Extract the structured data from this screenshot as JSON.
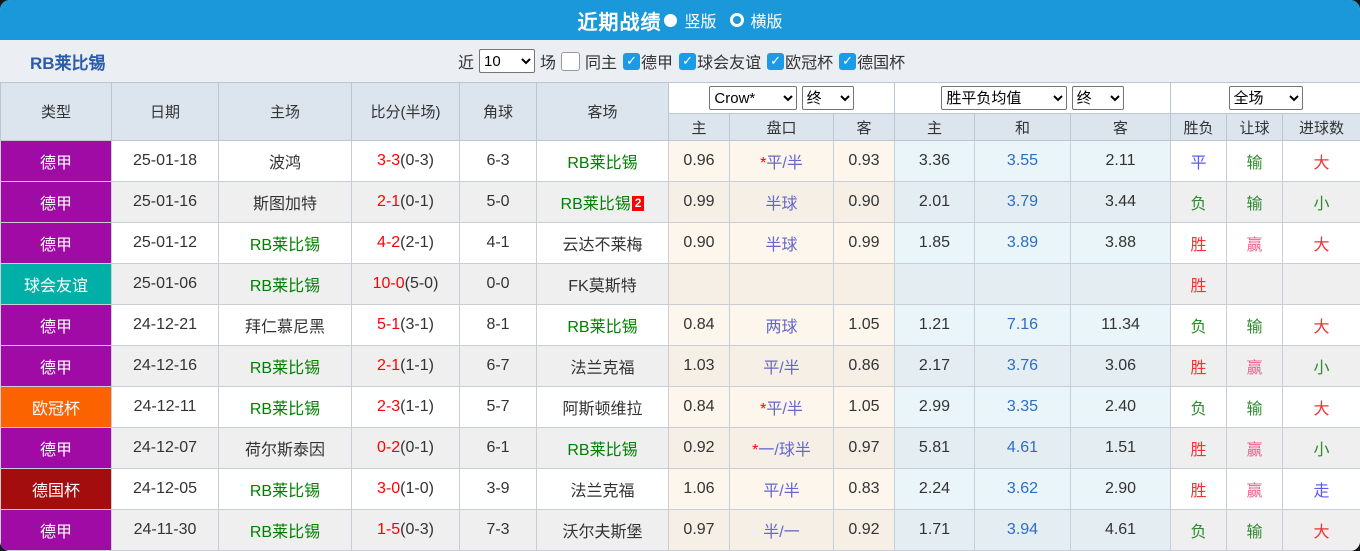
{
  "titlebar": {
    "title": "近期战绩",
    "radios": [
      {
        "label": "竖版",
        "selected": true
      },
      {
        "label": "横版",
        "selected": false
      }
    ]
  },
  "filter": {
    "team_title": "RB莱比锡",
    "recent_label": "近",
    "recent_value": "10",
    "matches_label": "场",
    "same_venue": {
      "label": "同主",
      "checked": false
    },
    "competitions": [
      {
        "label": "德甲",
        "checked": true
      },
      {
        "label": "球会友谊",
        "checked": true
      },
      {
        "label": "欧冠杯",
        "checked": true
      },
      {
        "label": "德国杯",
        "checked": true
      }
    ]
  },
  "table": {
    "left_headers": [
      "类型",
      "日期",
      "主场",
      "比分(半场)",
      "角球",
      "客场"
    ],
    "selects": {
      "company": "Crow*",
      "company_time": "终",
      "avg": "胜平负均值",
      "avg_time": "终",
      "scope": "全场"
    },
    "sub_headers": [
      "主",
      "盘口",
      "客",
      "主",
      "和",
      "客",
      "胜负",
      "让球",
      "进球数"
    ],
    "rows": [
      {
        "type": {
          "label": "德甲",
          "color": "#a10ba5"
        },
        "date": "25-01-18",
        "home": {
          "name": "波鸿",
          "highlight": false
        },
        "score": {
          "full": "3-3",
          "half": "(0-3)"
        },
        "corner": "6-3",
        "away": {
          "name": "RB莱比锡",
          "highlight": true,
          "badge": ""
        },
        "odds": {
          "home": "0.96",
          "star": true,
          "handicap": "平/半",
          "away": "0.93"
        },
        "avg": {
          "home": "3.36",
          "draw": "3.55",
          "away": "2.11"
        },
        "results": {
          "outcome": {
            "text": "平",
            "type": "draw"
          },
          "handicap": {
            "text": "输",
            "type": "lose"
          },
          "goals": {
            "text": "大",
            "type": "big"
          }
        }
      },
      {
        "type": {
          "label": "德甲",
          "color": "#a10ba5"
        },
        "date": "25-01-16",
        "home": {
          "name": "斯图加特",
          "highlight": false
        },
        "score": {
          "full": "2-1",
          "half": "(0-1)"
        },
        "corner": "5-0",
        "away": {
          "name": "RB莱比锡",
          "highlight": true,
          "badge": "2"
        },
        "odds": {
          "home": "0.99",
          "star": false,
          "handicap": "半球",
          "away": "0.90"
        },
        "avg": {
          "home": "2.01",
          "draw": "3.79",
          "away": "3.44"
        },
        "results": {
          "outcome": {
            "text": "负",
            "type": "lose"
          },
          "handicap": {
            "text": "输",
            "type": "lose"
          },
          "goals": {
            "text": "小",
            "type": "small"
          }
        }
      },
      {
        "type": {
          "label": "德甲",
          "color": "#a10ba5"
        },
        "date": "25-01-12",
        "home": {
          "name": "RB莱比锡",
          "highlight": true
        },
        "score": {
          "full": "4-2",
          "half": "(2-1)"
        },
        "corner": "4-1",
        "away": {
          "name": "云达不莱梅",
          "highlight": false,
          "badge": ""
        },
        "odds": {
          "home": "0.90",
          "star": false,
          "handicap": "半球",
          "away": "0.99"
        },
        "avg": {
          "home": "1.85",
          "draw": "3.89",
          "away": "3.88"
        },
        "results": {
          "outcome": {
            "text": "胜",
            "type": "win"
          },
          "handicap": {
            "text": "赢",
            "type": "win"
          },
          "goals": {
            "text": "大",
            "type": "big"
          }
        }
      },
      {
        "type": {
          "label": "球会友谊",
          "color": "#00b0a7"
        },
        "date": "25-01-06",
        "home": {
          "name": "RB莱比锡",
          "highlight": true
        },
        "score": {
          "full": "10-0",
          "half": "(5-0)"
        },
        "corner": "0-0",
        "away": {
          "name": "FK莫斯特",
          "highlight": false,
          "badge": ""
        },
        "odds": {
          "home": "",
          "star": false,
          "handicap": "",
          "away": ""
        },
        "avg": {
          "home": "",
          "draw": "",
          "away": ""
        },
        "results": {
          "outcome": {
            "text": "胜",
            "type": "win"
          },
          "handicap": {
            "text": "",
            "type": ""
          },
          "goals": {
            "text": "",
            "type": ""
          }
        }
      },
      {
        "type": {
          "label": "德甲",
          "color": "#a10ba5"
        },
        "date": "24-12-21",
        "home": {
          "name": "拜仁慕尼黑",
          "highlight": false
        },
        "score": {
          "full": "5-1",
          "half": "(3-1)"
        },
        "corner": "8-1",
        "away": {
          "name": "RB莱比锡",
          "highlight": true,
          "badge": ""
        },
        "odds": {
          "home": "0.84",
          "star": false,
          "handicap": "两球",
          "away": "1.05"
        },
        "avg": {
          "home": "1.21",
          "draw": "7.16",
          "away": "11.34"
        },
        "results": {
          "outcome": {
            "text": "负",
            "type": "lose"
          },
          "handicap": {
            "text": "输",
            "type": "lose"
          },
          "goals": {
            "text": "大",
            "type": "big"
          }
        }
      },
      {
        "type": {
          "label": "德甲",
          "color": "#a10ba5"
        },
        "date": "24-12-16",
        "home": {
          "name": "RB莱比锡",
          "highlight": true
        },
        "score": {
          "full": "2-1",
          "half": "(1-1)"
        },
        "corner": "6-7",
        "away": {
          "name": "法兰克福",
          "highlight": false,
          "badge": ""
        },
        "odds": {
          "home": "1.03",
          "star": false,
          "handicap": "平/半",
          "away": "0.86"
        },
        "avg": {
          "home": "2.17",
          "draw": "3.76",
          "away": "3.06"
        },
        "results": {
          "outcome": {
            "text": "胜",
            "type": "win"
          },
          "handicap": {
            "text": "赢",
            "type": "win"
          },
          "goals": {
            "text": "小",
            "type": "small"
          }
        }
      },
      {
        "type": {
          "label": "欧冠杯",
          "color": "#fb6300"
        },
        "date": "24-12-11",
        "home": {
          "name": "RB莱比锡",
          "highlight": true
        },
        "score": {
          "full": "2-3",
          "half": "(1-1)"
        },
        "corner": "5-7",
        "away": {
          "name": "阿斯顿维拉",
          "highlight": false,
          "badge": ""
        },
        "odds": {
          "home": "0.84",
          "star": true,
          "handicap": "平/半",
          "away": "1.05"
        },
        "avg": {
          "home": "2.99",
          "draw": "3.35",
          "away": "2.40"
        },
        "results": {
          "outcome": {
            "text": "负",
            "type": "lose"
          },
          "handicap": {
            "text": "输",
            "type": "lose"
          },
          "goals": {
            "text": "大",
            "type": "big"
          }
        }
      },
      {
        "type": {
          "label": "德甲",
          "color": "#a10ba5"
        },
        "date": "24-12-07",
        "home": {
          "name": "荷尔斯泰因",
          "highlight": false
        },
        "score": {
          "full": "0-2",
          "half": "(0-1)"
        },
        "corner": "6-1",
        "away": {
          "name": "RB莱比锡",
          "highlight": true,
          "badge": ""
        },
        "odds": {
          "home": "0.92",
          "star": true,
          "handicap": "一/球半",
          "away": "0.97"
        },
        "avg": {
          "home": "5.81",
          "draw": "4.61",
          "away": "1.51"
        },
        "results": {
          "outcome": {
            "text": "胜",
            "type": "win"
          },
          "handicap": {
            "text": "赢",
            "type": "win"
          },
          "goals": {
            "text": "小",
            "type": "small"
          }
        }
      },
      {
        "type": {
          "label": "德国杯",
          "color": "#a40d0d"
        },
        "date": "24-12-05",
        "home": {
          "name": "RB莱比锡",
          "highlight": true
        },
        "score": {
          "full": "3-0",
          "half": "(1-0)"
        },
        "corner": "3-9",
        "away": {
          "name": "法兰克福",
          "highlight": false,
          "badge": ""
        },
        "odds": {
          "home": "1.06",
          "star": false,
          "handicap": "平/半",
          "away": "0.83"
        },
        "avg": {
          "home": "2.24",
          "draw": "3.62",
          "away": "2.90"
        },
        "results": {
          "outcome": {
            "text": "胜",
            "type": "win"
          },
          "handicap": {
            "text": "赢",
            "type": "win"
          },
          "goals": {
            "text": "走",
            "type": "walk"
          }
        }
      },
      {
        "type": {
          "label": "德甲",
          "color": "#a10ba5"
        },
        "date": "24-11-30",
        "home": {
          "name": "RB莱比锡",
          "highlight": true
        },
        "score": {
          "full": "1-5",
          "half": "(0-3)"
        },
        "corner": "7-3",
        "away": {
          "name": "沃尔夫斯堡",
          "highlight": false,
          "badge": ""
        },
        "odds": {
          "home": "0.97",
          "star": false,
          "handicap": "半/一",
          "away": "0.92"
        },
        "avg": {
          "home": "1.71",
          "draw": "3.94",
          "away": "4.61"
        },
        "results": {
          "outcome": {
            "text": "负",
            "type": "lose"
          },
          "handicap": {
            "text": "输",
            "type": "lose"
          },
          "goals": {
            "text": "大",
            "type": "big"
          }
        }
      }
    ]
  },
  "theme": {
    "topbar_blue": "#1b98da",
    "filterbar_bg": "#ebeef3",
    "header_bg": "#dce4ee",
    "odds_bg": "#fdf6ed",
    "avg_bg": "#eaf5f9",
    "win_red": "#f03333",
    "lose_green": "#2e8b2e",
    "draw_blue": "#5a5af5",
    "covered_pink": "#f0608c",
    "team_green": "#008000",
    "score_red": "#ff0000",
    "handicap_purple": "#6666cc",
    "title_navy": "#2b5cab",
    "bundesliga_purple": "#a10ba5",
    "friendly_teal": "#00b0a7",
    "ucl_orange": "#fb6300",
    "dfb_pokal_red": "#a40d0d"
  }
}
